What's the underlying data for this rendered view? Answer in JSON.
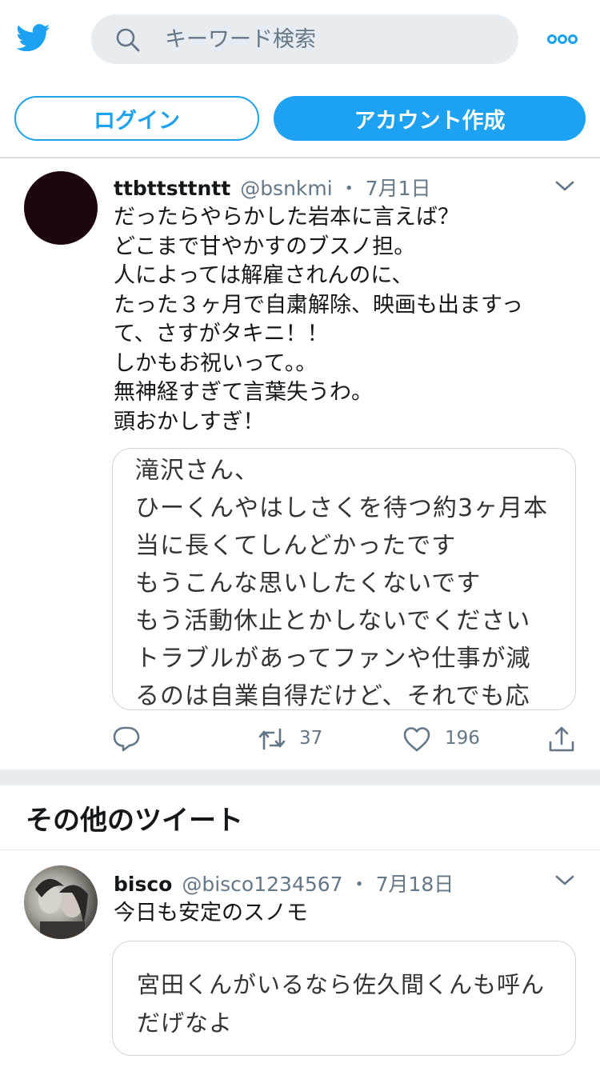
{
  "header": {
    "logo_icon": "twitter-bird-icon",
    "search_placeholder": "キーワード検索",
    "more_icon": "more-dots-icon"
  },
  "auth": {
    "login_label": "ログイン",
    "signup_label": "アカウント作成"
  },
  "tweet1": {
    "name": "ttbttsttntt",
    "handle": "@bsnkmi",
    "separator": "・",
    "time": "7月1日",
    "text": "だったらやらかした岩本に言えば？\nどこまで甘やかすのブスノ担。\n人によっては解雇されんのに、\nたった３ヶ月で自粛解除、映画も出ますっ\nて、さすがタキニ！！\nしかもお祝いって。。\n無神経すぎて言葉失うわ。\n頭おかしすぎ！",
    "card_text": "滝沢さん、\nひーくんやはしさくを待つ約3ヶ月本\n当に長くてしんどかったです\nもうこんな思いしたくないです\nもう活動休止とかしないでください\nトラブルがあってファンや仕事が減\nるのは自業自得だけど、それでも応",
    "retweets": "37",
    "likes": "196"
  },
  "section": {
    "title": "その他のツイート"
  },
  "tweet2": {
    "name": "bisco",
    "handle": "@bisco1234567",
    "separator": "・",
    "time": "7月18日",
    "text": "今日も安定のスノモ",
    "card_text": "宮田くんがいるなら佐久間くんも呼ん\nだげなよ"
  },
  "colors": {
    "brand": "#1da1f2",
    "muted": "#657786",
    "border": "#ccd6dd",
    "band": "#e6ecf0"
  }
}
